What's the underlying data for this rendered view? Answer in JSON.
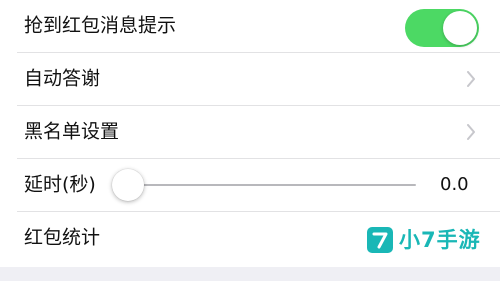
{
  "settings": {
    "rows": [
      {
        "label": "抢到红包消息提示",
        "control": "toggle",
        "toggle_on": true
      },
      {
        "label": "自动答谢",
        "control": "chevron"
      },
      {
        "label": "黑名单设置",
        "control": "chevron"
      },
      {
        "label": "延时(秒)",
        "control": "slider",
        "slider_value": 0.0,
        "value_text": "0.0"
      },
      {
        "label": "红包统计",
        "control": "none"
      }
    ]
  },
  "watermark": {
    "text": "小7手游",
    "logo_glyph": "7"
  },
  "colors": {
    "toggle_on": "#4cd964",
    "separator": "#e2e2e4",
    "chevron": "#c7c7cc",
    "watermark": "#19b7b6",
    "footer_bg": "#efeff4"
  }
}
